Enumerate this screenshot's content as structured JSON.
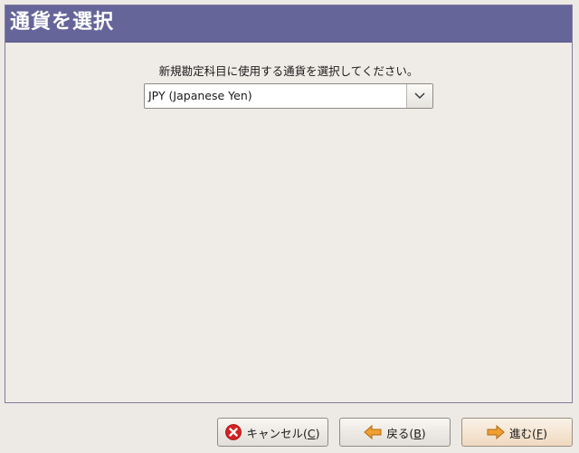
{
  "header": {
    "title": "通貨を選択"
  },
  "main": {
    "prompt": "新規勘定科目に使用する通貨を選択してください。",
    "currency_select": {
      "value": "JPY (Japanese Yen)"
    }
  },
  "buttons": {
    "cancel": {
      "label": "キャンセル(",
      "mnemonic": "C",
      "suffix": ")",
      "icon": "cancel-icon"
    },
    "back": {
      "label": "戻る(",
      "mnemonic": "B",
      "suffix": ")",
      "icon": "arrow-left-icon"
    },
    "forward": {
      "label": "進む(",
      "mnemonic": "F",
      "suffix": ")",
      "icon": "arrow-right-icon"
    }
  },
  "colors": {
    "header_bg": "#66659a",
    "cancel_icon": "#d62020",
    "arrow_icon": "#f0a030"
  }
}
